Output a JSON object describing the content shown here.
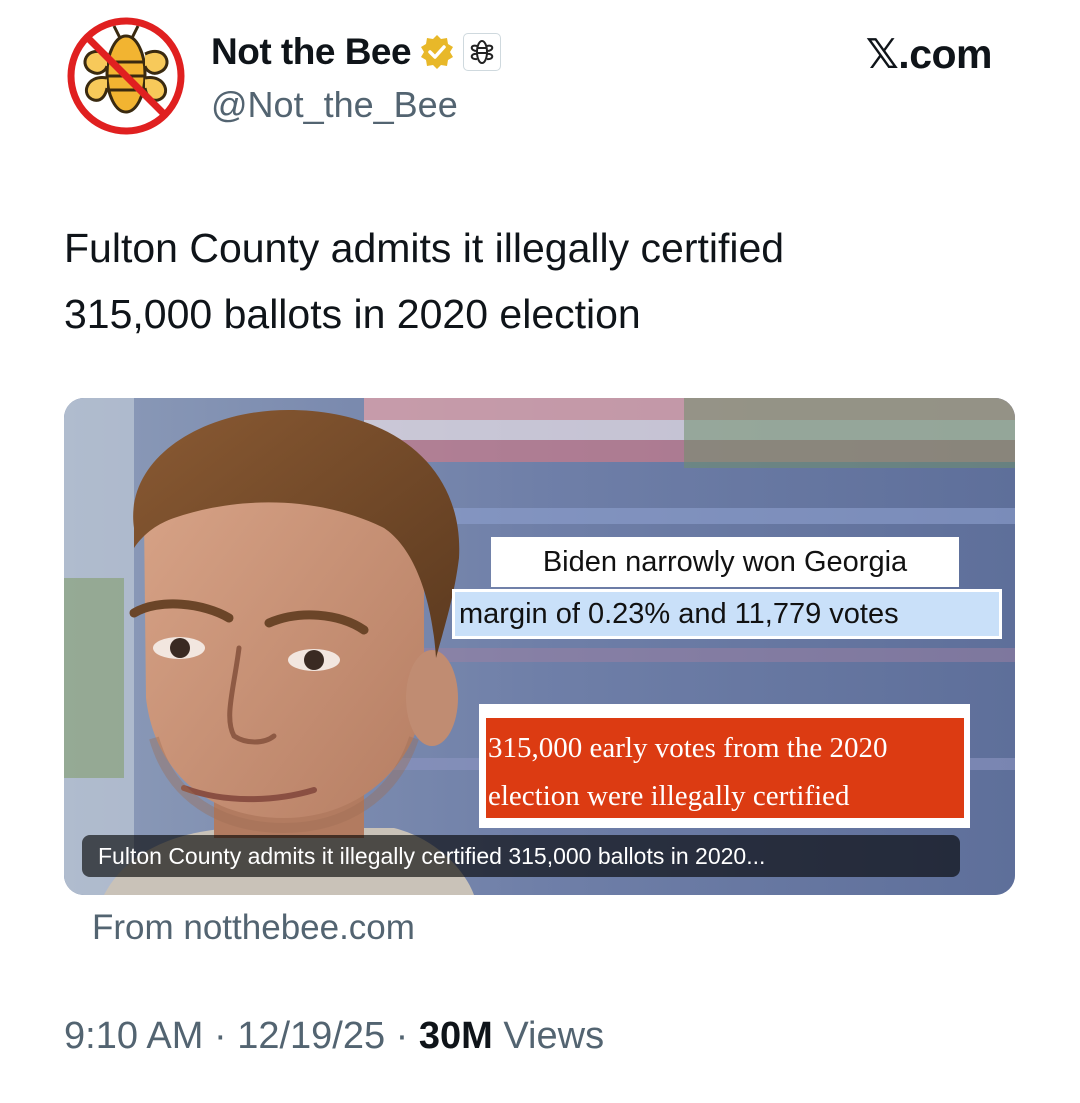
{
  "author": {
    "display_name": "Not the Bee",
    "handle": "@Not_the_Bee",
    "verified_badge_icon": "gold-checkmark-badge-icon",
    "affiliate_icon": "babylon-bee-logo-icon",
    "avatar_icon": "bee-in-no-symbol-icon"
  },
  "site_label": "𝕏.com",
  "tweet": {
    "text_line_1": "Fulton County admits it illegally certified",
    "text_line_2": "315,000 ballots in 2020 election"
  },
  "card": {
    "callout_1": "Biden narrowly won Georgia",
    "callout_2": "margin of 0.23% and 11,779 votes",
    "red_line_1": "315,000 early votes from the 2020",
    "red_line_2": "election were illegally certified",
    "caption": "Fulton County admits it illegally certified 315,000 ballots in 2020...",
    "source": "From notthebee.com"
  },
  "meta": {
    "time": "9:10 AM",
    "separator": " · ",
    "date": "12/19/25",
    "views_count": "30M",
    "views_label": " Views"
  },
  "colors": {
    "verified_gold": "#e8b829",
    "avatar_red": "#e02020",
    "avatar_bee": "#f2b431",
    "red_box": "#dc3b12",
    "blue_highlight": "#c9e0f9",
    "secondary_text": "#536471"
  }
}
